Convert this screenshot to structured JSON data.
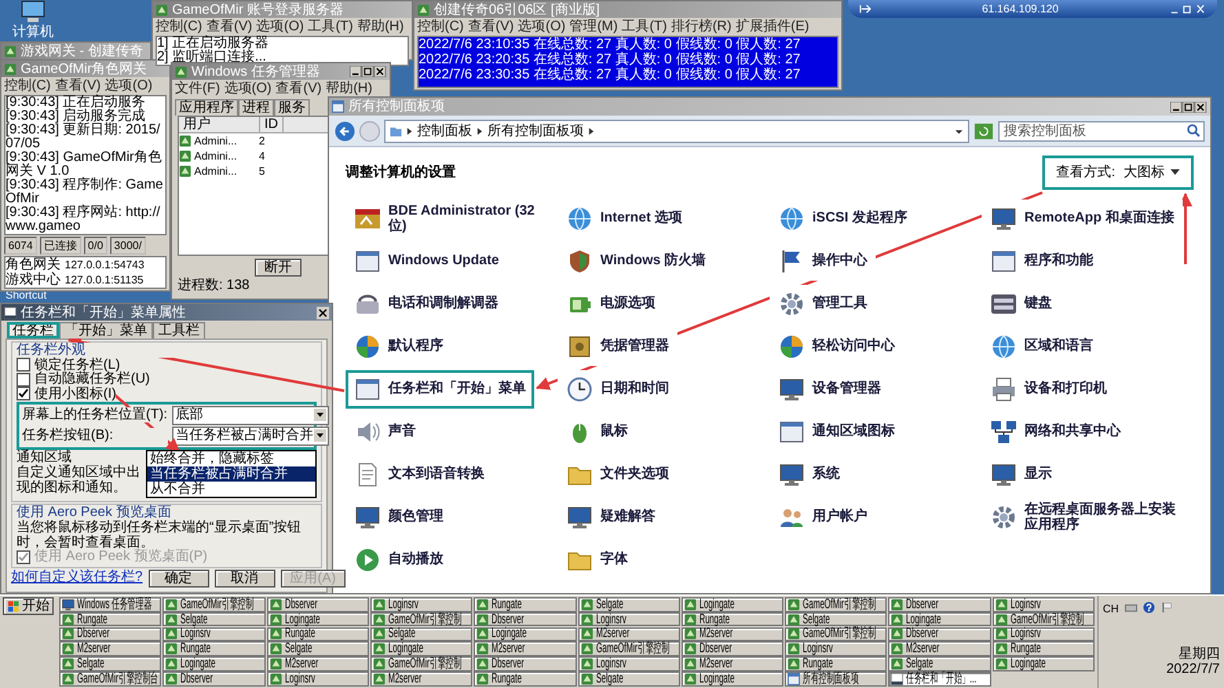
{
  "computer_icon": {
    "label": "计算机"
  },
  "shortcut_label": "Shortcut",
  "remote_bar": {
    "address": "61.164.109.120"
  },
  "login_server_window": {
    "title": "GameOfMir 账号登录服务器",
    "menu": [
      "控制(C)",
      "查看(V)",
      "选项(O)",
      "工具(T)",
      "帮助(H)"
    ],
    "log": [
      "1] 正在启动服务器",
      "2] 监听端口连接..."
    ]
  },
  "server_window": {
    "title": "创建传奇06引06区 [商业版]",
    "menu": [
      "控制(C)",
      "查看(V)",
      "选项(O)",
      "管理(M)",
      "工具(T)",
      "排行榜(R)",
      "扩展插件(E)"
    ],
    "log": [
      "2022/7/6 23:10:35 在线总数: 27 真人数: 0 假线数: 0 假人数: 27",
      "2022/7/6 23:20:35 在线总数: 27 真人数: 0 假线数: 0 假人数: 27",
      "2022/7/6 23:30:35 在线总数: 27 真人数: 0 假线数: 0 假人数: 27"
    ]
  },
  "gateway_window": {
    "back_title": "游戏网关 - 创建传奇",
    "title": "GameOfMir角色网关",
    "menu": [
      "控制(C)",
      "查看(V)",
      "选项(O)"
    ],
    "log": [
      "[9:30:43] 正在启动服务",
      "[9:30:43] 启动服务完成",
      "[9:30:43] 更新日期: 2015/07/05",
      "[9:30:43] GameOfMir角色网关 V 1.0",
      "[9:30:43] 程序制作: GameOfMir",
      "[9:30:43] 程序网站: http://www.gameo"
    ],
    "status": [
      "6074",
      "已连接",
      "0/0",
      "3000/"
    ],
    "connections": [
      {
        "name": "角色网关",
        "address": "127.0.0.1:54743"
      },
      {
        "name": "游戏中心",
        "address": "127.0.0.1:51135"
      }
    ]
  },
  "task_manager": {
    "title": "Windows 任务管理器",
    "menu": [
      "文件(F)",
      "选项(O)",
      "查看(V)",
      "帮助(H)"
    ],
    "tabs": [
      {
        "label": "应用程序",
        "selected": false
      },
      {
        "label": "进程",
        "selected": false
      },
      {
        "label": "服务",
        "selected": false
      }
    ],
    "columns": [
      "用户",
      "ID"
    ],
    "rows": [
      {
        "user": "Admini...",
        "id": "2"
      },
      {
        "user": "Admini...",
        "id": "4"
      },
      {
        "user": "Admini...",
        "id": "5"
      }
    ],
    "button": "断开",
    "status": "进程数: 138"
  },
  "control_panel": {
    "title": "所有控制面板项",
    "breadcrumb": [
      "控制面板",
      "所有控制面板项"
    ],
    "search": {
      "placeholder": "搜索控制面板"
    },
    "heading": "调整计算机的设置",
    "view": {
      "label": "查看方式:",
      "value": "大图标",
      "highlighted": true
    },
    "items": [
      {
        "label": "BDE Administrator (32 位)",
        "kind": "tools",
        "highlighted": false
      },
      {
        "label": "Internet 选项",
        "kind": "globe",
        "highlighted": false
      },
      {
        "label": "iSCSI 发起程序",
        "kind": "globe",
        "highlighted": false
      },
      {
        "label": "RemoteApp 和桌面连接",
        "kind": "monitor",
        "highlighted": false
      },
      {
        "label": "Windows Update",
        "kind": "window",
        "highlighted": false
      },
      {
        "label": "Windows 防火墙",
        "kind": "shield",
        "highlighted": false
      },
      {
        "label": "操作中心",
        "kind": "flag",
        "highlighted": false
      },
      {
        "label": "程序和功能",
        "kind": "window",
        "highlighted": false
      },
      {
        "label": "电话和调制解调器",
        "kind": "phone",
        "highlighted": false
      },
      {
        "label": "电源选项",
        "kind": "battery",
        "highlighted": false
      },
      {
        "label": "管理工具",
        "kind": "gear",
        "highlighted": false
      },
      {
        "label": "键盘",
        "kind": "keyboard",
        "highlighted": false
      },
      {
        "label": "默认程序",
        "kind": "orb",
        "highlighted": false
      },
      {
        "label": "凭据管理器",
        "kind": "safe",
        "highlighted": false
      },
      {
        "label": "轻松访问中心",
        "kind": "orb",
        "highlighted": false
      },
      {
        "label": "区域和语言",
        "kind": "globe",
        "highlighted": false
      },
      {
        "label": "任务栏和「开始」菜单",
        "kind": "window",
        "highlighted": true
      },
      {
        "label": "日期和时间",
        "kind": "clock",
        "highlighted": false
      },
      {
        "label": "设备管理器",
        "kind": "monitor",
        "highlighted": false
      },
      {
        "label": "设备和打印机",
        "kind": "printer",
        "highlighted": false
      },
      {
        "label": "声音",
        "kind": "speaker",
        "highlighted": false
      },
      {
        "label": "鼠标",
        "kind": "mouse",
        "highlighted": false
      },
      {
        "label": "通知区域图标",
        "kind": "window",
        "highlighted": false
      },
      {
        "label": "网络和共享中心",
        "kind": "network",
        "highlighted": false
      },
      {
        "label": "文本到语音转换",
        "kind": "document",
        "highlighted": false
      },
      {
        "label": "文件夹选项",
        "kind": "folder",
        "highlighted": false
      },
      {
        "label": "系统",
        "kind": "monitor",
        "highlighted": false
      },
      {
        "label": "显示",
        "kind": "monitor",
        "highlighted": false
      },
      {
        "label": "颜色管理",
        "kind": "monitor",
        "highlighted": false
      },
      {
        "label": "疑难解答",
        "kind": "monitor",
        "highlighted": false
      },
      {
        "label": "用户帐户",
        "kind": "user",
        "highlighted": false
      },
      {
        "label": "在远程桌面服务器上安装应用程序",
        "kind": "gear",
        "highlighted": false
      },
      {
        "label": "自动播放",
        "kind": "play",
        "highlighted": false
      },
      {
        "label": "字体",
        "kind": "folder",
        "highlighted": false
      }
    ]
  },
  "dialog": {
    "title": "任务栏和「开始」菜单属性",
    "tabs": [
      {
        "label": "任务栏",
        "selected": true,
        "highlighted": true
      },
      {
        "label": "「开始」菜单",
        "selected": false,
        "highlighted": false
      },
      {
        "label": "工具栏",
        "selected": false,
        "highlighted": false
      }
    ],
    "appearance": {
      "title": "任务栏外观",
      "checks": [
        {
          "label": "锁定任务栏(L)",
          "checked": false
        },
        {
          "label": "自动隐藏任务栏(U)",
          "checked": false
        },
        {
          "label": "使用小图标(I)",
          "checked": true
        }
      ],
      "highlighted": true,
      "position": {
        "label": "屏幕上的任务栏位置(T):",
        "value": "底部"
      },
      "buttons": {
        "label": "任务栏按钮(B):",
        "value": "当任务栏被占满时合并",
        "expanded": true,
        "options": [
          {
            "label": "始终合并，隐藏标签",
            "selected": false
          },
          {
            "label": "当任务栏被占满时合并",
            "selected": true
          },
          {
            "label": "从不合并",
            "selected": false
          }
        ]
      },
      "notification": {
        "title": "通知区域",
        "text": "自定义通知区域中出现的图标和通知。"
      }
    },
    "aero": {
      "title": "使用 Aero Peek 预览桌面",
      "text": "当您将鼠标移动到任务栏末端的“显示桌面”按钮时，会暂时查看桌面。",
      "check": {
        "label": "使用 Aero Peek 预览桌面(P)",
        "checked": true,
        "disabled": true
      }
    },
    "link": "如何自定义该任务栏?",
    "buttons": [
      {
        "label": "确定",
        "disabled": false
      },
      {
        "label": "取消",
        "disabled": false
      },
      {
        "label": "应用(A)",
        "disabled": true
      }
    ]
  },
  "taskbar": {
    "start": "开始",
    "items": [
      {
        "label": "Windows 任务管理器",
        "kind": "taskmgr",
        "selected": false
      },
      {
        "label": "GameOfMir引擎控制",
        "kind": "game",
        "selected": false
      },
      {
        "label": "Dbserver",
        "kind": "game",
        "selected": false
      },
      {
        "label": "Loginsrv",
        "kind": "game",
        "selected": false
      },
      {
        "label": "Rungate",
        "kind": "game",
        "selected": false
      },
      {
        "label": "Selgate",
        "kind": "game",
        "selected": false
      },
      {
        "label": "Logingate",
        "kind": "game",
        "selected": false
      },
      {
        "label": "GameOfMir引擎控制",
        "kind": "game",
        "selected": false
      },
      {
        "label": "Dbserver",
        "kind": "game",
        "selected": false
      },
      {
        "label": "Loginsrv",
        "kind": "game",
        "selected": false
      },
      {
        "label": "Rungate",
        "kind": "game",
        "selected": false
      },
      {
        "label": "Selgate",
        "kind": "game",
        "selected": false
      },
      {
        "label": "Logingate",
        "kind": "game",
        "selected": false
      },
      {
        "label": "GameOfMir引擎控制",
        "kind": "game",
        "selected": false
      },
      {
        "label": "Dbserver",
        "kind": "game",
        "selected": false
      },
      {
        "label": "Loginsrv",
        "kind": "game",
        "selected": false
      },
      {
        "label": "Rungate",
        "kind": "game",
        "selected": false
      },
      {
        "label": "Selgate",
        "kind": "game",
        "selected": false
      },
      {
        "label": "Logingate",
        "kind": "game",
        "selected": false
      },
      {
        "label": "GameOfMir引擎控制",
        "kind": "game",
        "selected": false
      },
      {
        "label": "Dbserver",
        "kind": "game",
        "selected": false
      },
      {
        "label": "Loginsrv",
        "kind": "game",
        "selected": false
      },
      {
        "label": "Rungate",
        "kind": "game",
        "selected": false
      },
      {
        "label": "Selgate",
        "kind": "game",
        "selected": false
      },
      {
        "label": "Logingate",
        "kind": "game",
        "selected": false
      },
      {
        "label": "M2server",
        "kind": "game",
        "selected": false
      },
      {
        "label": "M2server",
        "kind": "game",
        "selected": false
      },
      {
        "label": "GameOfMir引擎控制",
        "kind": "game",
        "selected": false
      },
      {
        "label": "Dbserver",
        "kind": "game",
        "selected": false
      },
      {
        "label": "Loginsrv",
        "kind": "game",
        "selected": false
      },
      {
        "label": "M2server",
        "kind": "game",
        "selected": false
      },
      {
        "label": "Rungate",
        "kind": "game",
        "selected": false
      },
      {
        "label": "Selgate",
        "kind": "game",
        "selected": false
      },
      {
        "label": "Logingate",
        "kind": "game",
        "selected": false
      },
      {
        "label": "M2server",
        "kind": "game",
        "selected": false
      },
      {
        "label": "GameOfMir引擎控制",
        "kind": "game",
        "selected": false
      },
      {
        "label": "Dbserver",
        "kind": "game",
        "selected": false
      },
      {
        "label": "Loginsrv",
        "kind": "game",
        "selected": false
      },
      {
        "label": "M2server",
        "kind": "game",
        "selected": false
      },
      {
        "label": "Rungate",
        "kind": "game",
        "selected": false
      },
      {
        "label": "Selgate",
        "kind": "game",
        "selected": false
      },
      {
        "label": "Logingate",
        "kind": "game",
        "selected": false
      },
      {
        "label": "M2server",
        "kind": "game",
        "selected": false
      },
      {
        "label": "GameOfMir引擎控制",
        "kind": "game",
        "selected": false
      },
      {
        "label": "Dbserver",
        "kind": "game",
        "selected": false
      },
      {
        "label": "Loginsrv",
        "kind": "game",
        "selected": false
      },
      {
        "label": "M2server",
        "kind": "game",
        "selected": false
      },
      {
        "label": "Rungate",
        "kind": "game",
        "selected": false
      },
      {
        "label": "Selgate",
        "kind": "game",
        "selected": false
      },
      {
        "label": "Logingate",
        "kind": "game",
        "selected": false
      },
      {
        "label": "GameOfMir引擎控制台",
        "kind": "game",
        "selected": false
      },
      {
        "label": "Dbserver",
        "kind": "game",
        "selected": false
      },
      {
        "label": "Loginsrv",
        "kind": "game",
        "selected": false
      },
      {
        "label": "M2server",
        "kind": "game",
        "selected": false
      },
      {
        "label": "Rungate",
        "kind": "game",
        "selected": false
      },
      {
        "label": "Selgate",
        "kind": "game",
        "selected": false
      },
      {
        "label": "Logingate",
        "kind": "game",
        "selected": false
      },
      {
        "label": "所有控制面板项",
        "kind": "cpanel",
        "selected": false
      },
      {
        "label": "任务栏和「开始」...",
        "kind": "taskbar",
        "selected": true
      }
    ],
    "tray": {
      "language": "CH",
      "day": "星期四",
      "date": "2022/7/7"
    }
  }
}
